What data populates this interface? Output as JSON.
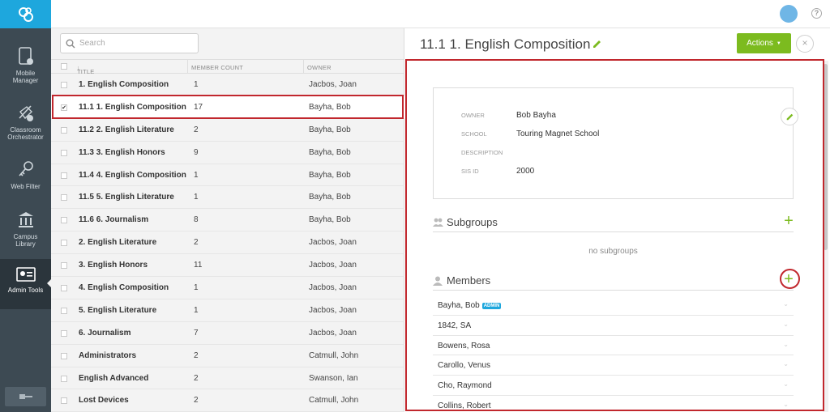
{
  "nav": {
    "items": [
      {
        "label": "Mobile Manager",
        "line1": "Mobile",
        "line2": "Manager"
      },
      {
        "label": "Classroom Orchestrator",
        "line1": "Classroom",
        "line2": "Orchestrator"
      },
      {
        "label": "Web Filter",
        "line1": "Web Filter",
        "line2": ""
      },
      {
        "label": "Campus Library",
        "line1": "Campus",
        "line2": "Library"
      },
      {
        "label": "Admin Tools",
        "line1": "Admin Tools",
        "line2": ""
      }
    ],
    "active": "Admin Tools"
  },
  "search": {
    "placeholder": "Search"
  },
  "list": {
    "headers": {
      "title": "TITLE",
      "member_count": "MEMBER COUNT",
      "owner": "OWNER"
    },
    "rows": [
      {
        "title": "1. English Composition",
        "count": "1",
        "owner": "Jacbos, Joan",
        "checked": false
      },
      {
        "title": "11.1 1. English Composition",
        "count": "17",
        "owner": "Bayha, Bob",
        "checked": true
      },
      {
        "title": "11.2 2. English Literature",
        "count": "2",
        "owner": "Bayha, Bob",
        "checked": false
      },
      {
        "title": "11.3 3. English Honors",
        "count": "9",
        "owner": "Bayha, Bob",
        "checked": false
      },
      {
        "title": "11.4 4. English Composition",
        "count": "1",
        "owner": "Bayha, Bob",
        "checked": false
      },
      {
        "title": "11.5 5. English Literature",
        "count": "1",
        "owner": "Bayha, Bob",
        "checked": false
      },
      {
        "title": "11.6 6. Journalism",
        "count": "8",
        "owner": "Bayha, Bob",
        "checked": false
      },
      {
        "title": "2. English Literature",
        "count": "2",
        "owner": "Jacbos, Joan",
        "checked": false
      },
      {
        "title": "3. English Honors",
        "count": "11",
        "owner": "Jacbos, Joan",
        "checked": false
      },
      {
        "title": "4. English Composition",
        "count": "1",
        "owner": "Jacbos, Joan",
        "checked": false
      },
      {
        "title": "5. English Literature",
        "count": "1",
        "owner": "Jacbos, Joan",
        "checked": false
      },
      {
        "title": "6. Journalism",
        "count": "7",
        "owner": "Jacbos, Joan",
        "checked": false
      },
      {
        "title": "Administrators",
        "count": "2",
        "owner": "Catmull, John",
        "checked": false
      },
      {
        "title": "English Advanced",
        "count": "2",
        "owner": "Swanson, Ian",
        "checked": false
      },
      {
        "title": "Lost Devices",
        "count": "2",
        "owner": "Catmull, John",
        "checked": false
      }
    ]
  },
  "detail": {
    "title": "11.1 1. English Composition",
    "actions_label": "Actions",
    "close_label": "×",
    "info": {
      "owner_label": "OWNER",
      "owner": "Bob Bayha",
      "school_label": "SCHOOL",
      "school": "Touring Magnet School",
      "description_label": "DESCRIPTION",
      "description": "",
      "sisid_label": "SIS ID",
      "sisid": "2000"
    },
    "subgroups_title": "Subgroups",
    "no_subgroups": "no subgroups",
    "members_title": "Members",
    "admin_badge": "ADMIN",
    "members": [
      {
        "name": "Bayha, Bob",
        "admin": true
      },
      {
        "name": "1842, SA",
        "admin": false
      },
      {
        "name": "Bowens, Rosa",
        "admin": false
      },
      {
        "name": "Carollo, Venus",
        "admin": false
      },
      {
        "name": "Cho, Raymond",
        "admin": false
      },
      {
        "name": "Collins, Robert",
        "admin": false
      }
    ]
  },
  "colors": {
    "brand": "#1ea7dd",
    "accent_green": "#7cbb1f",
    "highlight_red": "#c1272d",
    "nav_bg": "#3d4a53"
  }
}
